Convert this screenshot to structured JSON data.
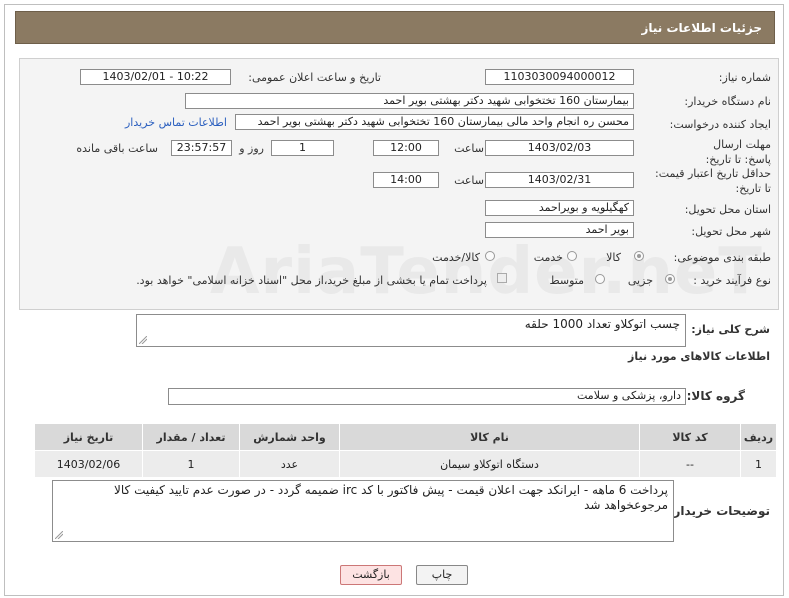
{
  "header": {
    "title": "جزئیات اطلاعات نیاز"
  },
  "form": {
    "need_number_label": "شماره نیاز:",
    "need_number": "1103030094000012",
    "announce_label": "تاریخ و ساعت اعلان عمومی:",
    "announce_value": "1403/02/01 - 10:22",
    "buyer_org_label": "نام دستگاه خریدار:",
    "buyer_org": "بیمارستان 160 تختخوابی شهید دکتر بهشتی بویر احمد",
    "creator_label": "ایجاد کننده درخواست:",
    "creator": "محسن ره انجام واحد مالی بیمارستان 160 تختخوابی شهید دکتر بهشتی بویر احمد",
    "contact_link": "اطلاعات تماس خریدار",
    "reply_deadline_label": "مهلت ارسال پاسخ: تا تاریخ:",
    "reply_date": "1403/02/03",
    "time_label": "ساعت",
    "reply_time": "12:00",
    "days_value": "1",
    "days_label": "روز و",
    "remaining_value": "23:57:57",
    "remaining_label": "ساعت باقی مانده",
    "price_validity_label": "حداقل تاریخ اعتبار قیمت: تا تاریخ:",
    "price_date": "1403/02/31",
    "price_time": "14:00",
    "province_label": "استان محل تحویل:",
    "province": "کهگیلویه و بویراحمد",
    "city_label": "شهر محل تحویل:",
    "city": "بویر احمد",
    "category_label": "طبقه بندی موضوعی:",
    "category_options": [
      "کالا",
      "خدمت",
      "کالا/خدمت"
    ],
    "process_label": "نوع فرآیند خرید :",
    "process_options": [
      "جزیی",
      "متوسط"
    ],
    "payment_note": "پرداخت تمام یا بخشی از مبلغ خرید،از محل \"اسناد خزانه اسلامی\" خواهد بود."
  },
  "watermark": "AriaTender.neT",
  "description": {
    "label": "شرح کلی نیاز:",
    "value": "چسب اتوکلاو تعداد 1000 حلقه"
  },
  "goods_section_title": "اطلاعات کالاهای مورد نیاز",
  "goods_group": {
    "label": "گروه کالا:",
    "value": "دارو، پزشکی و سلامت"
  },
  "table": {
    "headers": [
      "ردیف",
      "کد کالا",
      "نام کالا",
      "واحد شمارش",
      "تعداد / مقدار",
      "تاریخ نیاز"
    ],
    "rows": [
      [
        "1",
        "--",
        "دستگاه اتوکلاو سیمان",
        "عدد",
        "1",
        "1403/02/06"
      ]
    ]
  },
  "buyer_notes": {
    "label": "توضیحات خریدار:",
    "value": "پرداخت 6 ماهه - ایرانکد جهت اعلان قیمت - پیش فاکتور با کد irc ضمیمه گردد - در صورت عدم تایید کیفیت کالا مرجوعخواهد شد"
  },
  "buttons": {
    "print": "چاپ",
    "back": "بازگشت"
  }
}
